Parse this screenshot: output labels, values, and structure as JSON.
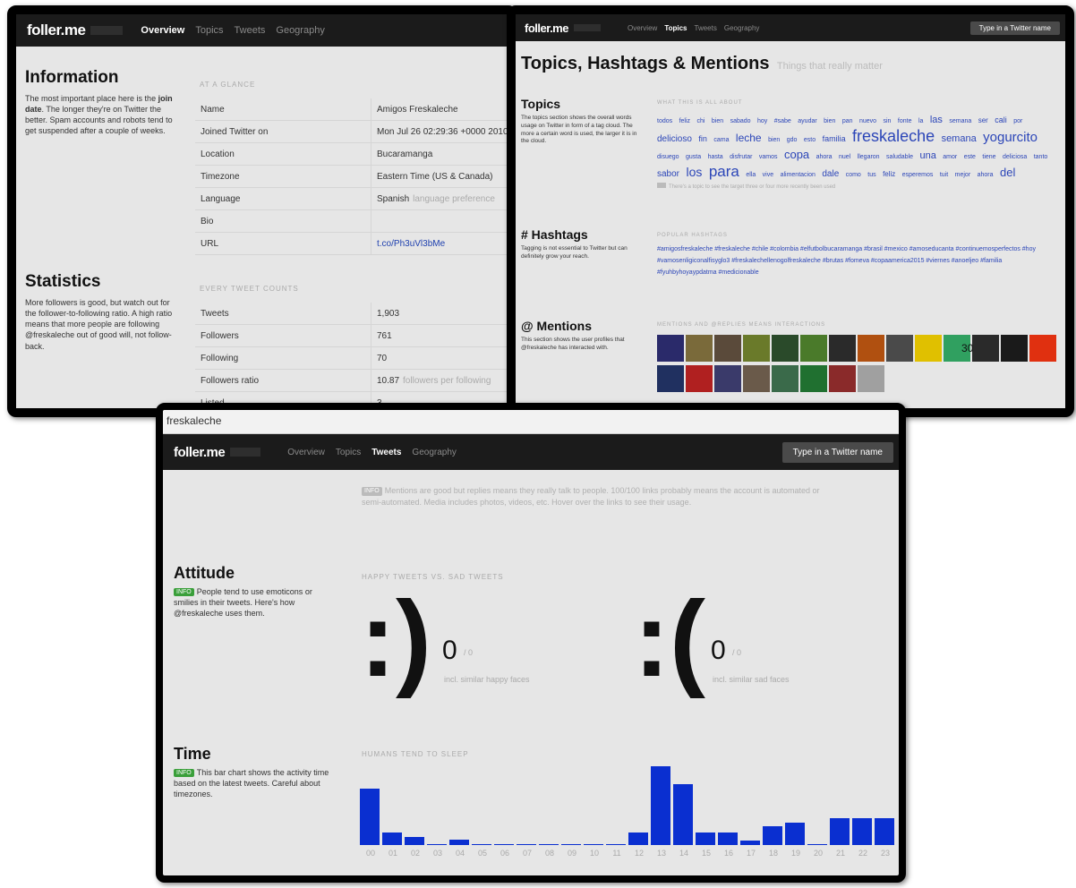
{
  "brand": "foller.me",
  "nav": [
    "Overview",
    "Topics",
    "Tweets",
    "Geography"
  ],
  "search_button": "Type in a Twitter name",
  "overview": {
    "information_title": "Information",
    "information_desc_pre": "The most important place here is the ",
    "information_desc_bold": "join date",
    "information_desc_post": ". The longer they're on Twitter the better. Spam accounts and robots tend to get suspended after a couple of weeks.",
    "glance_caption": "AT A GLANCE",
    "rows": [
      {
        "k": "Name",
        "v": "Amigos Freskaleche",
        "note": ""
      },
      {
        "k": "Joined Twitter on",
        "v": "Mon Jul 26 02:29:36 +0000 2010",
        "note": ""
      },
      {
        "k": "Location",
        "v": "Bucaramanga",
        "note": ""
      },
      {
        "k": "Timezone",
        "v": "Eastern Time (US & Canada)",
        "note": ""
      },
      {
        "k": "Language",
        "v": "Spanish",
        "note": "language preference"
      },
      {
        "k": "Bio",
        "v": "",
        "note": ""
      },
      {
        "k": "URL",
        "v": "t.co/Ph3uVl3bMe",
        "note": ""
      }
    ],
    "statistics_title": "Statistics",
    "statistics_desc": "More followers is good, but watch out for the follower-to-following ratio. A high ratio means that more people are following @freskaleche out of good will, not follow-back.",
    "counts_caption": "EVERY TWEET COUNTS",
    "stats": [
      {
        "k": "Tweets",
        "v": "1,903",
        "note": ""
      },
      {
        "k": "Followers",
        "v": "761",
        "note": ""
      },
      {
        "k": "Following",
        "v": "70",
        "note": ""
      },
      {
        "k": "Followers ratio",
        "v": "10.87",
        "note": "followers per following"
      },
      {
        "k": "Listed",
        "v": "3",
        "note": ""
      }
    ]
  },
  "topics": {
    "page_title": "Topics, Hashtags & Mentions",
    "page_subtitle": "Things that really matter",
    "topics_title": "Topics",
    "topics_desc": "The topics section shows the overall words usage on Twitter in form of a tag cloud. The more a certain word is used, the larger it is in the cloud.",
    "topics_caption": "WHAT THIS IS ALL ABOUT",
    "cloud": [
      {
        "w": "todos",
        "s": 7
      },
      {
        "w": "feliz",
        "s": 7
      },
      {
        "w": "chi",
        "s": 7
      },
      {
        "w": "bien",
        "s": 7
      },
      {
        "w": "sabado",
        "s": 7
      },
      {
        "w": "hoy",
        "s": 7
      },
      {
        "w": "#sabe",
        "s": 7
      },
      {
        "w": "ayudar",
        "s": 7
      },
      {
        "w": "bien",
        "s": 7
      },
      {
        "w": "pan",
        "s": 7
      },
      {
        "w": "nuevo",
        "s": 7
      },
      {
        "w": "sin",
        "s": 7
      },
      {
        "w": "fonte",
        "s": 7
      },
      {
        "w": "la",
        "s": 7
      },
      {
        "w": "las",
        "s": 11
      },
      {
        "w": "semana",
        "s": 7
      },
      {
        "w": "ser",
        "s": 8
      },
      {
        "w": "cali",
        "s": 9
      },
      {
        "w": "por",
        "s": 7
      },
      {
        "w": "delicioso",
        "s": 10
      },
      {
        "w": "fin",
        "s": 9
      },
      {
        "w": "cama",
        "s": 7
      },
      {
        "w": "leche",
        "s": 12
      },
      {
        "w": "bien",
        "s": 7
      },
      {
        "w": "gdo",
        "s": 7
      },
      {
        "w": "esto",
        "s": 7
      },
      {
        "w": "familia",
        "s": 9
      },
      {
        "w": "freskaleche",
        "s": 18
      },
      {
        "w": "semana",
        "s": 11
      },
      {
        "w": "yogurcito",
        "s": 15
      },
      {
        "w": "disuego",
        "s": 7
      },
      {
        "w": "gusta",
        "s": 7
      },
      {
        "w": "hasta",
        "s": 7
      },
      {
        "w": "disfrutar",
        "s": 7
      },
      {
        "w": "vamos",
        "s": 7
      },
      {
        "w": "copa",
        "s": 13
      },
      {
        "w": "ahora",
        "s": 7
      },
      {
        "w": "nuel",
        "s": 7
      },
      {
        "w": "llegaron",
        "s": 7
      },
      {
        "w": "saludable",
        "s": 7
      },
      {
        "w": "una",
        "s": 11
      },
      {
        "w": "amor",
        "s": 7
      },
      {
        "w": "este",
        "s": 7
      },
      {
        "w": "tiene",
        "s": 7
      },
      {
        "w": "deliciosa",
        "s": 7
      },
      {
        "w": "tanto",
        "s": 7
      },
      {
        "w": "sabor",
        "s": 10
      },
      {
        "w": "los",
        "s": 14
      },
      {
        "w": "para",
        "s": 17
      },
      {
        "w": "ella",
        "s": 7
      },
      {
        "w": "vive",
        "s": 7
      },
      {
        "w": "alimentacion",
        "s": 7
      },
      {
        "w": "dale",
        "s": 10
      },
      {
        "w": "como",
        "s": 7
      },
      {
        "w": "tus",
        "s": 7
      },
      {
        "w": "feliz",
        "s": 8
      },
      {
        "w": "esperemos",
        "s": 7
      },
      {
        "w": "tuit",
        "s": 7
      },
      {
        "w": "mejor",
        "s": 7
      },
      {
        "w": "ahora",
        "s": 7
      },
      {
        "w": "del",
        "s": 13
      }
    ],
    "cloud_note": "There's a topic to see the target three or four more recently been used",
    "hashtags_title": "# Hashtags",
    "hashtags_desc": "Tagging is not essential to Twitter but can definitely grow your reach.",
    "hashtags_caption": "POPULAR HASHTAGS",
    "hashtags": "#amigosfreskaleche #freskaleche #chile #colombia #elfutbolbucaramanga #brasil #mexico #amoseducanta #continuemosperfectos #hoy #vamosenligiconalfisyglo3 #freskalechellenogolfreskaleche #brutas #fomeva #copaamerica2015 #viernes #anoeljeo #familia #fyuhbyhoyaypdatma #medicionable",
    "mentions_title": "@ Mentions",
    "mentions_desc": "This section shows the user profiles that @freskaleche has interacted with.",
    "mentions_caption": "MENTIONS AND @REPLIES MEANS INTERACTIONS",
    "mention_count": "30",
    "thumb_colors_row1": [
      "#2a2a6a",
      "#7a6a3a",
      "#5a4a3a",
      "#6a7a2a",
      "#2a4a2a",
      "#4a7a2a",
      "#2a2a2a",
      "#b05010",
      "#4a4a4a",
      "#e0c000",
      "#30a060",
      "#2a2a2a",
      "#1a1a1a",
      "#e03010"
    ],
    "thumb_colors_row2": [
      "#203060",
      "#b02020",
      "#3a3a6a",
      "#6a5a4a",
      "#3a6a4a",
      "#207030",
      "#8a2a2a",
      "#a0a0a0"
    ]
  },
  "tweets": {
    "url_text": "freskaleche",
    "intro_badge": "INFO",
    "intro": "Mentions are good but replies means they really talk to people. 100/100 links probably means the account is automated or semi-automated. Media includes photos, videos, etc. Hover over the links to see their usage.",
    "attitude_title": "Attitude",
    "attitude_badge": "INFO",
    "attitude_desc": "People tend to use emoticons or smilies in their tweets. Here's how @freskaleche uses them.",
    "attitude_caption": "HAPPY TWEETS VS. SAD TWEETS",
    "happy_face": ":)",
    "happy_count": "0",
    "happy_pct": "/ 0",
    "happy_label": "incl. similar happy faces",
    "sad_face": ":(",
    "sad_count": "0",
    "sad_pct": "/ 0",
    "sad_label": "incl. similar sad faces",
    "time_title": "Time",
    "time_badge": "INFO",
    "time_desc": "This bar chart shows the activity time based on the latest tweets. Careful about timezones.",
    "time_caption": "HUMANS TEND TO SLEEP"
  },
  "chart_data": {
    "type": "bar",
    "categories": [
      "00",
      "01",
      "02",
      "03",
      "04",
      "05",
      "06",
      "07",
      "08",
      "09",
      "10",
      "11",
      "12",
      "13",
      "14",
      "15",
      "16",
      "17",
      "18",
      "19",
      "20",
      "21",
      "22",
      "23"
    ],
    "values": [
      56,
      12,
      8,
      1,
      5,
      1,
      1,
      1,
      1,
      1,
      1,
      1,
      12,
      78,
      60,
      12,
      12,
      4,
      19,
      22,
      1,
      27,
      27,
      27
    ],
    "ylim": [
      0,
      80
    ],
    "color": "#0a2fd0"
  }
}
